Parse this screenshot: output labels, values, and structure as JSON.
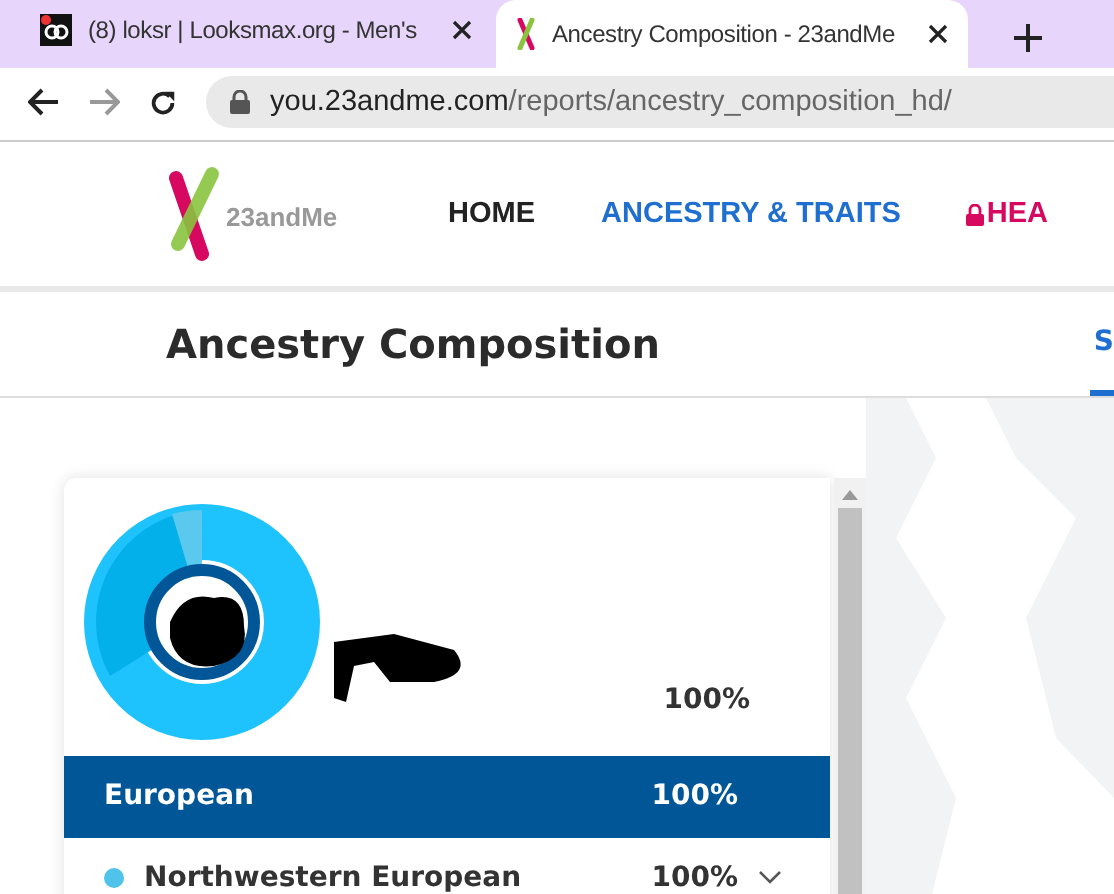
{
  "browser": {
    "tabs": [
      {
        "title": "(8) loksr | Looksmax.org - Men's",
        "selected": false,
        "kind": "forum"
      },
      {
        "title": "Ancestry Composition - 23andMe",
        "selected": true,
        "kind": "dna"
      }
    ],
    "url": {
      "host": "you.23andme.com",
      "path": "/reports/ancestry_composition_hd/"
    }
  },
  "site": {
    "logo": "23andMe",
    "nav": [
      {
        "label": "HOME",
        "selected": false,
        "locked": false
      },
      {
        "label": "ANCESTRY & TRAITS",
        "selected": true,
        "locked": false
      },
      {
        "label": "HEA",
        "selected": false,
        "locked": true
      }
    ]
  },
  "page": {
    "title": "Ancestry Composition",
    "tabs": [
      {
        "label": "S",
        "selected": true
      }
    ]
  },
  "card": {
    "summary_percent": "100%",
    "rows": [
      {
        "label": "European",
        "percent": "100%",
        "selected": true
      },
      {
        "label": "Northwestern European",
        "percent": "100%",
        "selected": false,
        "expanded": false,
        "color": "#4fc3ea"
      }
    ]
  }
}
